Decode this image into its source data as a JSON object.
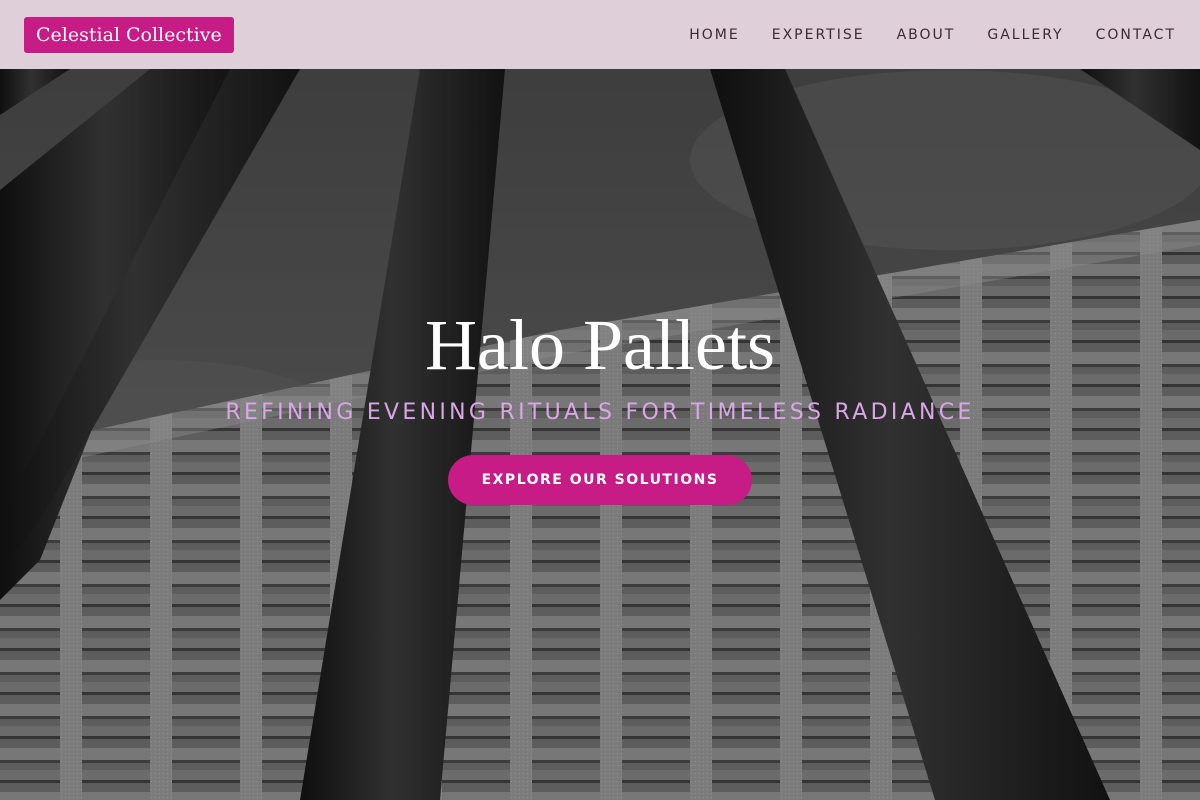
{
  "nav": {
    "brand": "Celestial Collective",
    "links": [
      "HOME",
      "EXPERTISE",
      "ABOUT",
      "GALLERY",
      "CONTACT"
    ]
  },
  "hero": {
    "title": "Halo Pallets",
    "subtitle": "REFINING EVENING RITUALS FOR TIMELESS RADIANCE",
    "cta_label": "EXPLORE OUR SOLUTIONS"
  },
  "colors": {
    "accent": "#c71b86",
    "nav_background": "#ecdae4",
    "subtitle": "#d9a6e6",
    "title": "#ffffff"
  }
}
